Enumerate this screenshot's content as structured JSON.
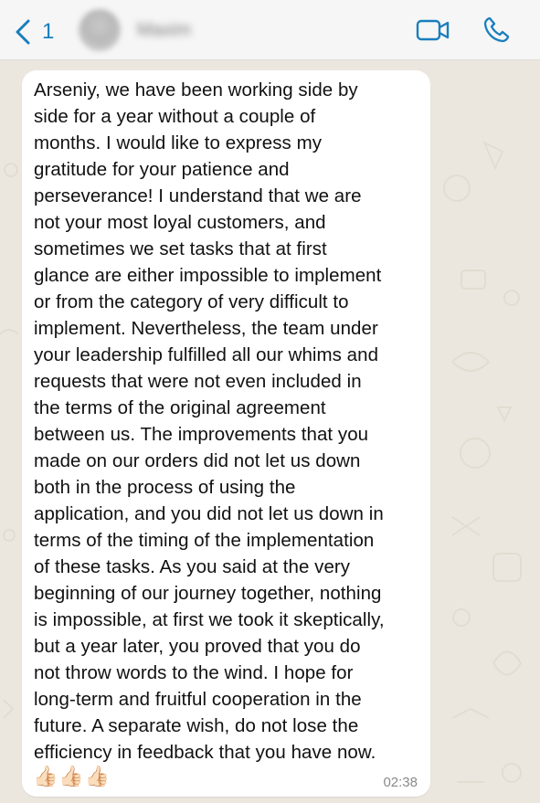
{
  "header": {
    "back_count": "1",
    "contact_name": "Maxim",
    "accent_color": "#1a7ebd"
  },
  "icons": {
    "back": "chevron-left-icon",
    "video": "video-camera-icon",
    "call": "phone-icon"
  },
  "message": {
    "text": "Arseniy, we have been working side by\nside for a year without a couple of\nmonths. I would like to express my\ngratitude for your patience and\nperseverance! I understand that we are\nnot your most loyal customers, and\nsometimes we set tasks that at first\nglance are either impossible to implement\nor from the category of very difficult to\nimplement. Nevertheless, the team under\nyour leadership fulfilled all our whims and\nrequests that were not even included in\nthe terms of the original agreement\nbetween us. The improvements that you\nmade on our orders did not let us down\nboth in the process of using the\napplication, and you did not let us down in\nterms of the timing of the implementation\nof these tasks. As you said at the very\nbeginning of our journey together, nothing\nis impossible, at first we took it skeptically,\nbut a year later, you proved that you do\nnot throw words to the wind. I hope for\nlong-term and fruitful cooperation in the\nfuture. A separate wish, do not lose the\nefficiency in feedback that you have now.",
    "reactions": "👍🏻👍🏻👍🏻",
    "time": "02:38"
  }
}
